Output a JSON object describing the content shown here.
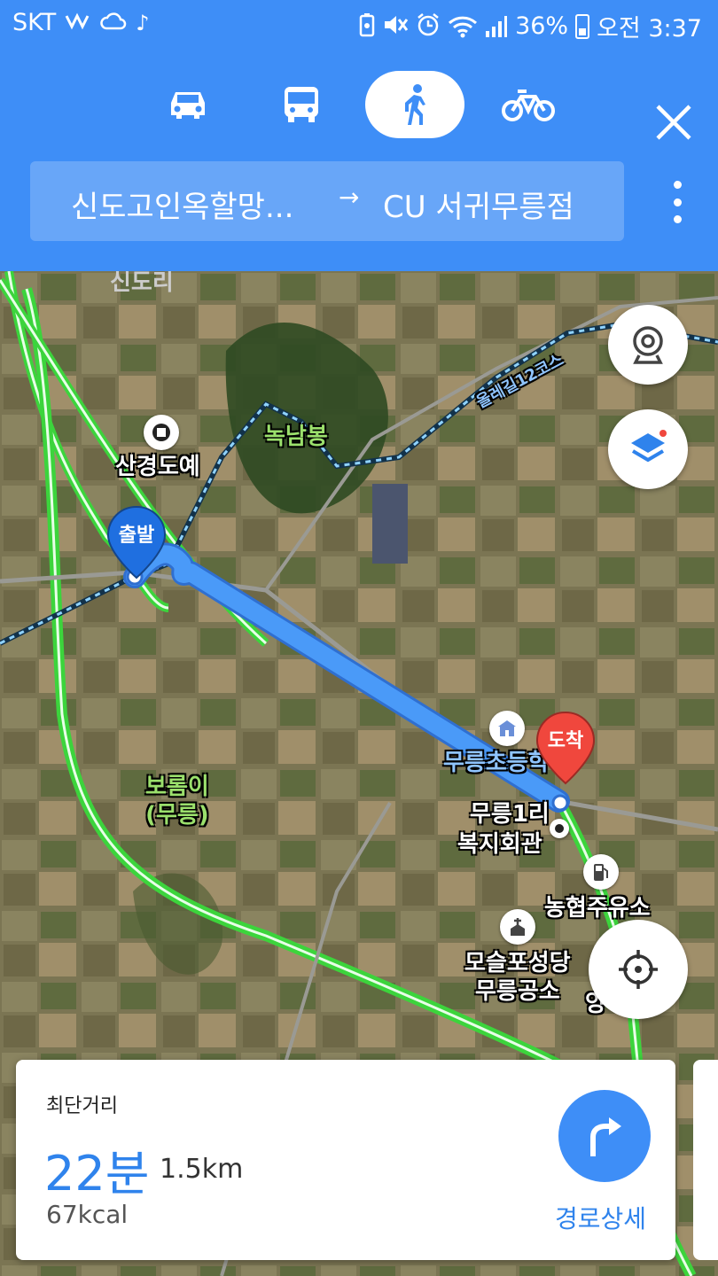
{
  "status_bar": {
    "carrier": "SKT",
    "battery": "36%",
    "time": "오전 3:37"
  },
  "header": {
    "modes": [
      {
        "name": "car",
        "active": false
      },
      {
        "name": "bus",
        "active": false
      },
      {
        "name": "walk",
        "active": true
      },
      {
        "name": "bike",
        "active": false
      }
    ],
    "route": {
      "from": "신도고인옥할망...",
      "arrow": "→",
      "to": "CU 서귀무릉점"
    }
  },
  "map": {
    "labels": {
      "village_top": "신도리",
      "bunjang": "산경도예",
      "peak": "녹남봉",
      "olle": "올레길12코스",
      "oreum": "보롬이\n(무릉)",
      "school": "무릉초등학",
      "hall_1": "무릉1리",
      "hall_2": "복지회관",
      "gas": "농협주유소",
      "church_1": "모슬포성당",
      "church_2": "무릉공소",
      "cemetery": "양 묘지"
    },
    "pins": {
      "start": "출발",
      "end": "도착"
    }
  },
  "summary": {
    "type": "최단거리",
    "time": "22분",
    "distance": "1.5km",
    "kcal": "67kcal",
    "detail_label": "경로상세"
  }
}
